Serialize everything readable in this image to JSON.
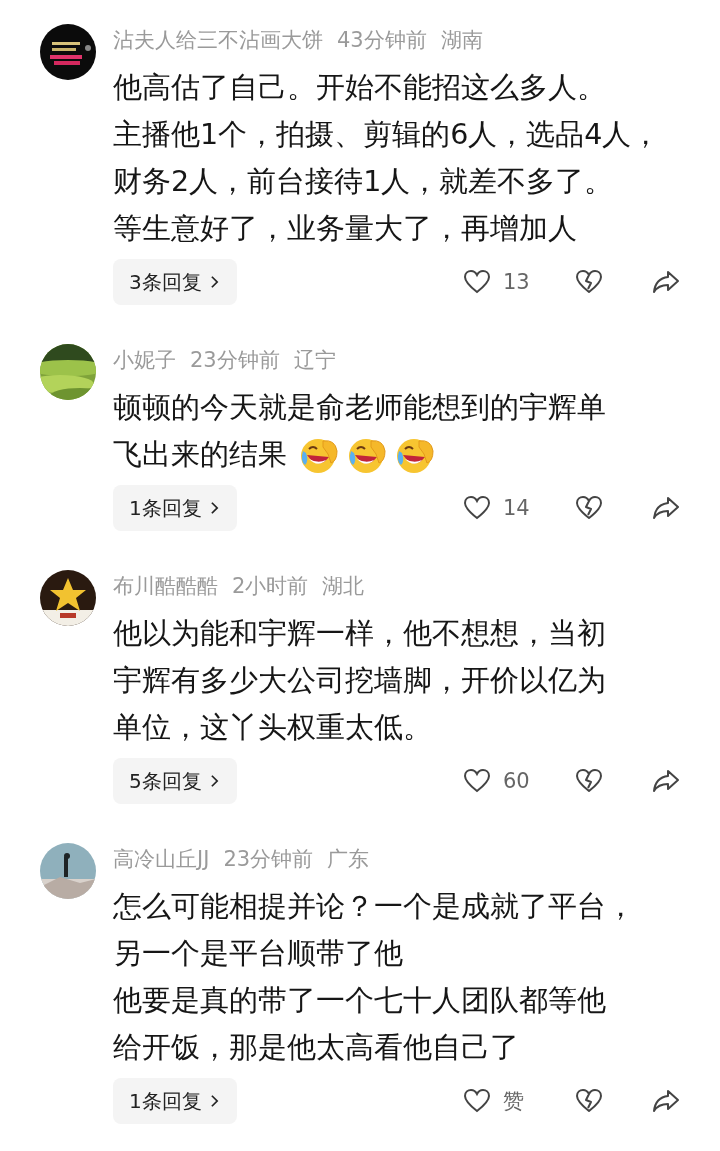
{
  "comments": [
    {
      "avatar": {
        "kind": "picture"
      },
      "user": "沾夫人给三不沾画大饼",
      "time": "43分钟前",
      "region": "湖南",
      "body": [
        "他高估了自己。开始不能招这么多人。",
        "主播他1个，拍摄、剪辑的6人，选品4人，",
        "财务2人，前台接待1人，就差不多了。",
        "等生意好了，业务量大了，再增加人"
      ],
      "replies": "3条回复",
      "likes": "13"
    },
    {
      "avatar": {
        "kind": "picture"
      },
      "user": "小妮子",
      "time": "23分钟前",
      "region": "辽宁",
      "body": [
        "顿顿的今天就是俞老师能想到的宇辉单",
        "飞出来的结果"
      ],
      "emojis": [
        {
          "kind": "laugh-cry"
        },
        {
          "kind": "laugh-cry"
        },
        {
          "kind": "laugh-cry"
        }
      ],
      "replies": "1条回复",
      "likes": "14"
    },
    {
      "avatar": {
        "kind": "picture"
      },
      "user": "布川酷酷酷",
      "time": "2小时前",
      "region": "湖北",
      "body": [
        "他以为能和宇辉一样，他不想想，当初",
        "宇辉有多少大公司挖墙脚，开价以亿为",
        "单位，这丫头权重太低。"
      ],
      "replies": "5条回复",
      "likes": "60"
    },
    {
      "avatar": {
        "kind": "picture"
      },
      "user": "高冷山丘JJ",
      "time": "23分钟前",
      "region": "广东",
      "body": [
        "怎么可能相提并论？一个是成就了平台，",
        "另一个是平台顺带了他",
        "他要是真的带了一个七十人团队都等他",
        "给开饭，那是他太高看他自己了"
      ],
      "replies": "1条回复",
      "likes": "赞"
    }
  ]
}
